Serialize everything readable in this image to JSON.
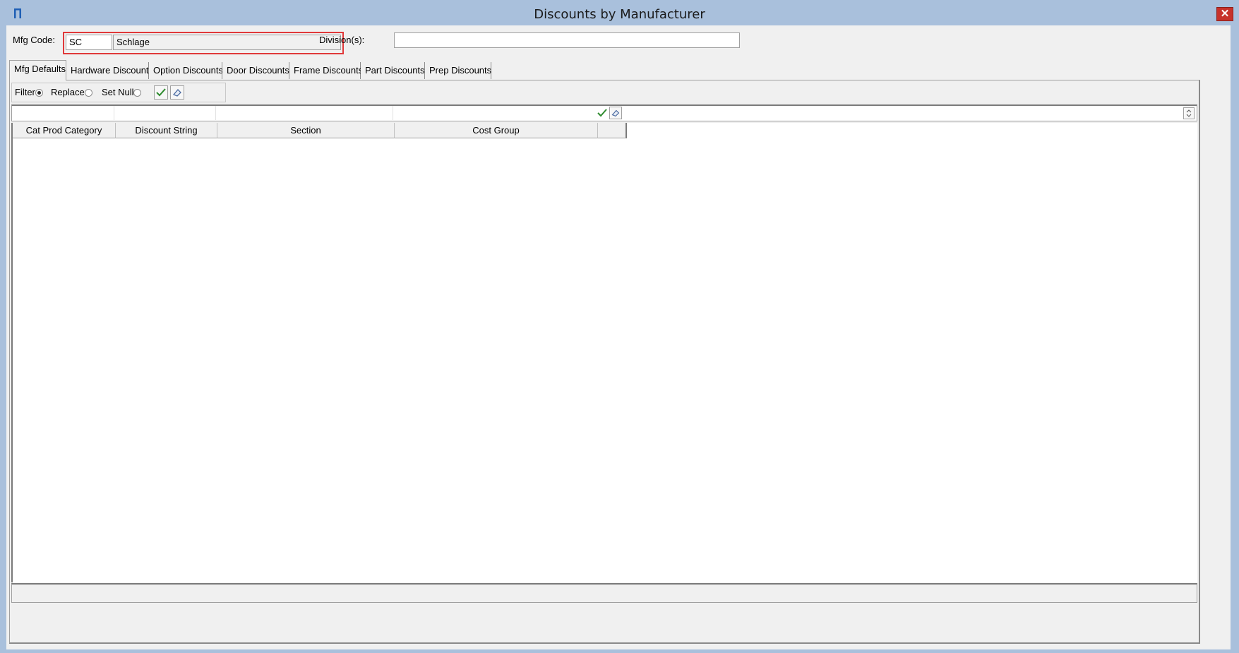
{
  "window": {
    "title": "Discounts by Manufacturer",
    "close_label": "✕",
    "icon": "app-logo-icon"
  },
  "header": {
    "mfg_code_label": "Mfg Code:",
    "mfg_code_value": "SC",
    "mfg_name_value": "Schlage",
    "divisions_label": "Division(s):",
    "divisions_value": ""
  },
  "tabs": [
    {
      "label": "Mfg Defaults",
      "active": true
    },
    {
      "label": "Hardware Discounts",
      "active": false
    },
    {
      "label": "Option Discounts",
      "active": false
    },
    {
      "label": "Door Discounts",
      "active": false
    },
    {
      "label": "Frame Discounts",
      "active": false
    },
    {
      "label": "Part Discounts",
      "active": false
    },
    {
      "label": "Prep Discounts",
      "active": false
    }
  ],
  "toolbar": {
    "filter_label": "Filter",
    "replace_label": "Replace",
    "setnull_label": "Set Null",
    "selected_mode": "Filter",
    "apply_icon": "check-icon",
    "clear_icon": "eraser-icon"
  },
  "grid": {
    "columns": [
      "Cat Prod Category",
      "Discount String",
      "Section",
      "Cost Group",
      ""
    ],
    "rows": []
  },
  "colors": {
    "frame": "#a9c0dc",
    "client": "#f0f0f0",
    "highlight": "#e0393a",
    "close": "#c7322b"
  }
}
